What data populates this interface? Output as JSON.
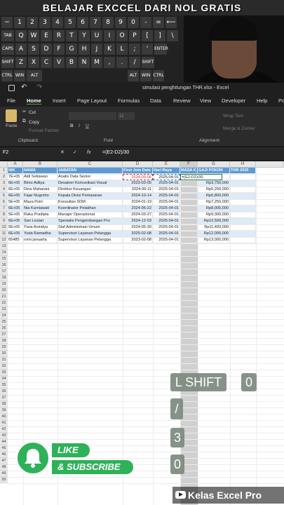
{
  "banner": {
    "title": "BELAJAR EXCCEL DARI NOL GRATIS"
  },
  "keyboard": {
    "row1": [
      "~",
      "1",
      "2",
      "3",
      "4",
      "5",
      "6",
      "7",
      "8",
      "9",
      "0",
      "-",
      "=",
      "⟵"
    ],
    "row2": [
      "TAB",
      "Q",
      "W",
      "E",
      "R",
      "T",
      "Y",
      "U",
      "I",
      "O",
      "P",
      "[",
      "]",
      "\\"
    ],
    "row3": [
      "CAPS",
      "A",
      "S",
      "D",
      "F",
      "G",
      "H",
      "J",
      "K",
      "L",
      ";",
      "'",
      "ENTER"
    ],
    "row4": [
      "SHIFT",
      "Z",
      "X",
      "C",
      "V",
      "B",
      "N",
      "M",
      ",",
      ".",
      "/",
      "SHIFT"
    ],
    "row5": [
      "CTRL",
      "WIN",
      "ALT",
      "ALT",
      "WIN",
      "CTRL"
    ]
  },
  "window": {
    "title": "simulasi penghitungan THR.xlsx - Excel"
  },
  "ribbon_tabs": [
    "File",
    "Home",
    "Insert",
    "Page Layout",
    "Formulas",
    "Data",
    "Review",
    "View",
    "Developer",
    "Help",
    "Po"
  ],
  "ribbon": {
    "paste": "Paste",
    "cut": "Cut",
    "copy": "Copy",
    "format_painter": "Format Painter",
    "clipboard": "Clipboard",
    "font": "Font",
    "font_size": "11",
    "alignment": "Alignment",
    "wrap_text": "Wrap Text",
    "merge_center": "Merge & Center"
  },
  "formula_bar": {
    "name_box": "F2",
    "fx": "fx",
    "formula": "=(E2-D2)/30"
  },
  "columns": [
    "A",
    "B",
    "C",
    "D",
    "E",
    "F",
    "G",
    "H"
  ],
  "row_numbers": [
    "1",
    "2",
    "3",
    "4",
    "5",
    "6",
    "7",
    "8",
    "9",
    "10",
    "11",
    "12",
    "13",
    "14",
    "15",
    "16",
    "17",
    "18",
    "19",
    "20",
    "21",
    "22",
    "23",
    "24",
    "25",
    "26",
    "27",
    "28",
    "29",
    "30",
    "31",
    "32",
    "33",
    "34",
    "35",
    "36",
    "37",
    "38",
    "39",
    "40",
    "41",
    "42",
    "43",
    "44",
    "45",
    "46",
    "47",
    "48",
    "49",
    "50"
  ],
  "headers": [
    "NIK",
    "NAMA",
    "JABATAN",
    "First Join Date",
    "Hari Raya",
    "MASA K",
    "GAJI POKOK",
    "THR 2025"
  ],
  "rows": [
    [
      "7E+05",
      "Aldi Setiawan",
      "Analis Data Senior",
      "2024-09-06",
      "2025-04-01",
      "=(E2-D2)/30",
      ""
    ],
    [
      "6E+05",
      "Bimo Aditya",
      "Desainer Komunikasi Visual",
      "2023-03-05",
      "2025-04-01",
      "",
      "Rp3,750,000"
    ],
    [
      "6E+05",
      "Dina Maharani",
      "Direktur Keuangan",
      "2024-06-11",
      "2025-04-01",
      "",
      "Rp5,200,000"
    ],
    [
      "6E+05",
      "Fajar Nugroho",
      "Kepala Divisi Pemasaran",
      "2024-10-14",
      "2025-04-01",
      "",
      "Rp6,800,000"
    ],
    [
      "5E+05",
      "Maya Putri",
      "Konsultan SDM",
      "2024-01-19",
      "2025-04-01",
      "",
      "Rp7,250,000"
    ],
    [
      "6E+05",
      "Nia Kurniawati",
      "Koordinator Pelatihan",
      "2024-06-22",
      "2025-04-01",
      "",
      "Rp8,000,000"
    ],
    [
      "5E+05",
      "Raka Pradipta",
      "Manajer Operasional",
      "2024-03-27",
      "2025-04-01",
      "",
      "Rp9,300,000"
    ],
    [
      "6E+05",
      "Sari Lestari",
      "Spesialis Pengembangan Pro",
      "2024-12-03",
      "2025-04-01",
      "",
      "Rp10,500,000"
    ],
    [
      "5E+05",
      "Tiara Anindya",
      "Staf Administrasi Umum",
      "2024-05-30",
      "2025-04-01",
      "",
      "Rp11,400,000"
    ],
    [
      "6E+05",
      "Yuda Ramadha",
      "Supervisor Layanan Pelangga",
      "2025-02-08",
      "2025-04-01",
      "",
      "Rp12,000,000"
    ],
    [
      "65485",
      "romi januarta",
      "Supervisor Layanan Pelangga",
      "2023-02-08",
      "2025-04-01",
      "",
      "Rp13,000,000"
    ]
  ],
  "key_overlays": [
    "L SHIFT",
    "0",
    "/",
    "3",
    "0"
  ],
  "subscribe": {
    "like": "LIKE",
    "subscribe": "& SUBSCRIBE"
  },
  "brand": {
    "name": "Kelas Excel Pro"
  }
}
